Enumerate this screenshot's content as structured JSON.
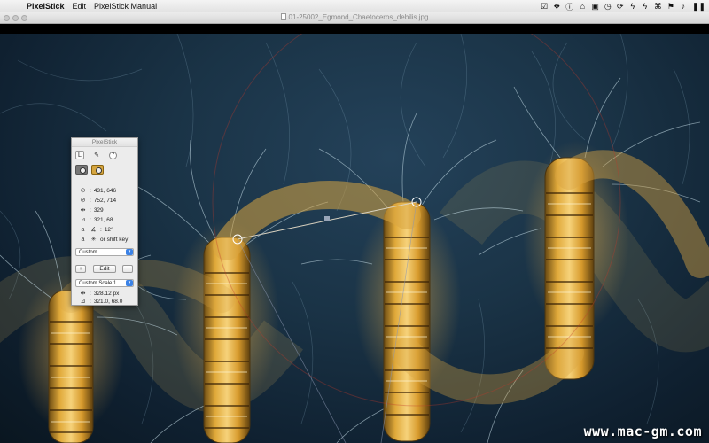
{
  "menubar": {
    "app_name": "PixelStick",
    "items": [
      "Edit",
      "PixelStick Manual"
    ],
    "status_icons": [
      "check-icon",
      "dropbox-icon",
      "info-icon",
      "home-icon",
      "lock-icon",
      "clock-icon",
      "sync-icon",
      "bolt-icon",
      "bolt-icon",
      "command-icon",
      "flag-icon",
      "bell-icon",
      "pause-icon"
    ]
  },
  "window": {
    "title": "01-25002_Egmond_Chaetoceros_debilis.jpg"
  },
  "palette": {
    "title": "PixelStick",
    "start": "431, 646",
    "end": "752, 714",
    "distance": "329",
    "delta": "321, 68",
    "angle": "12°",
    "constrain": "or shift key",
    "scale_mode": "Custom",
    "edit_label": "Edit",
    "add_label": "+",
    "remove_label": "−",
    "custom_scale": "Custom Scale 1",
    "scaled_distance": "328.12 px",
    "scaled_delta": "321.0, 68.0"
  },
  "watermark": "www.mac-gm.com",
  "colors": {
    "background": "#1a3346",
    "diatom": "#d39a2a",
    "accent": "#3b82e6"
  }
}
